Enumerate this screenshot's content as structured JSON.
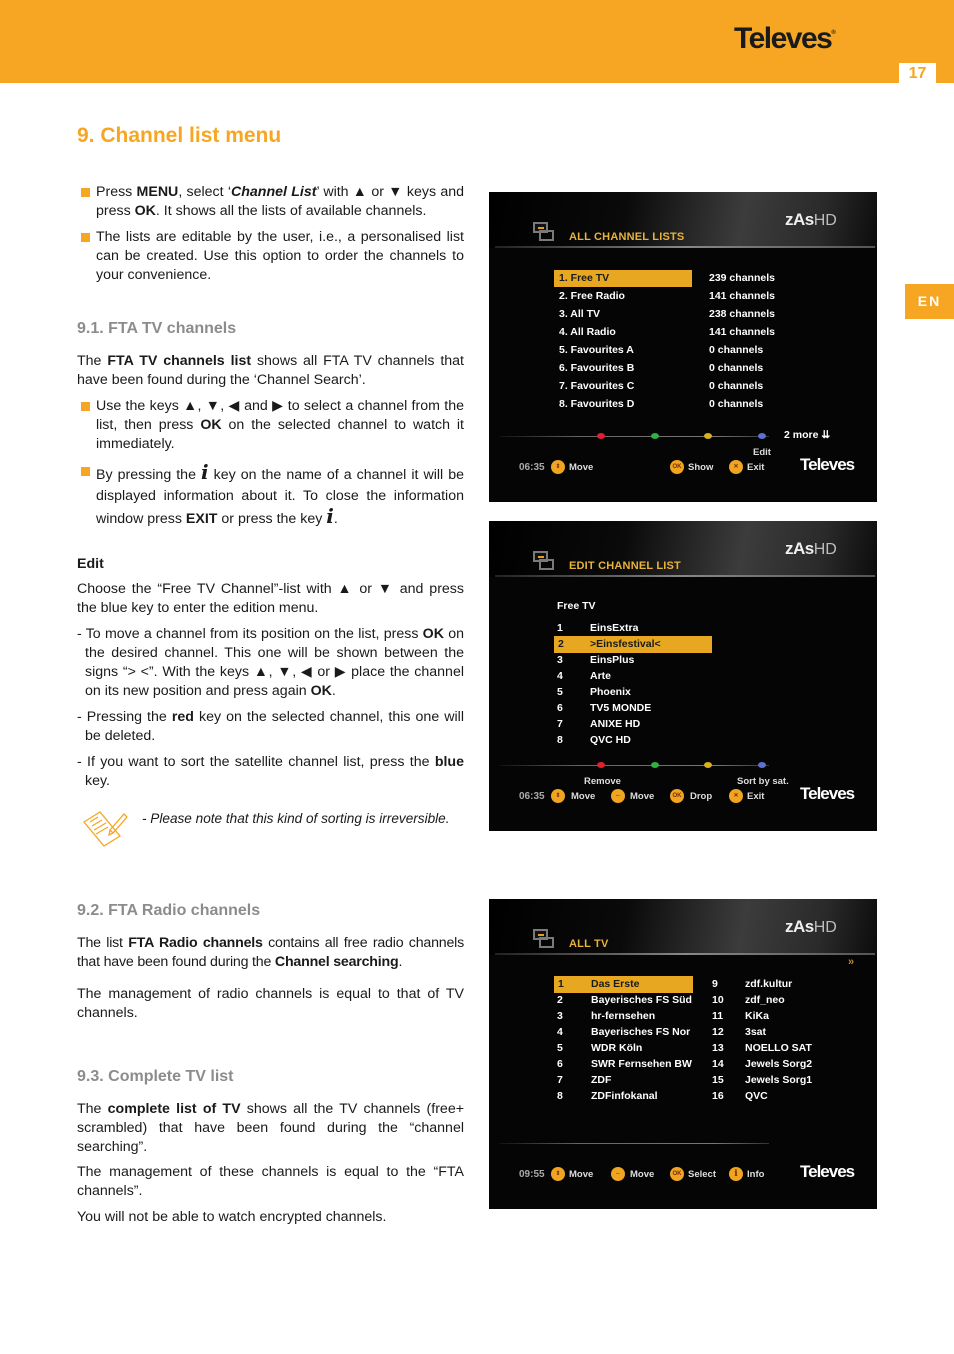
{
  "header": {
    "brand": "Televes",
    "page_number": "17",
    "language_tab": "EN",
    "accent_color": "#f6a623"
  },
  "section": {
    "title": "9. Channel list menu",
    "intro_bullets": [
      {
        "parts": [
          "Press ",
          "MENU",
          ", select ‘",
          "Channel List",
          "’ with ▲ or ▼ keys and press ",
          "OK",
          ". It shows all the lists of available channels."
        ]
      },
      {
        "text": "The lists are editable by the user, i.e., a personalised list can be created. Use this option to order the channels to your convenience."
      }
    ]
  },
  "fta_tv": {
    "title": "9.1. FTA TV channels",
    "intro": [
      "The ",
      "FTA TV channels list",
      " shows all FTA TV channels that have been found during the ‘Channel Search’."
    ],
    "bullets": [
      [
        "Use the keys ▲, ▼, ◀ and ▶ to select a channel from the list, then press ",
        "OK",
        " on the selected channel to watch it immediately."
      ],
      [
        "By pressing the ",
        "i",
        " key on the name of a channel it will be displayed information about it. To close the information window press ",
        "EXIT",
        " or press the key ",
        "i",
        "."
      ]
    ],
    "edit": {
      "title": "Edit",
      "intro": "Choose the “Free TV Channel”-list with ▲ or ▼ and press the blue key to enter the edition menu.",
      "items": [
        [
          "- To move a channel from its position on the list, press ",
          "OK",
          " on the desired channel. This one will be shown between the signs “> <”. With the keys ▲, ▼, ◀ or ▶ place the channel on its new position and press again ",
          "OK",
          "."
        ],
        [
          "- Pressing the ",
          "red",
          " key on the selected channel, this one will be deleted."
        ],
        [
          "- If you want to sort the satellite channel list, press the ",
          "blue",
          " key."
        ]
      ],
      "note": "- Please note that this kind of sorting is irreversible."
    }
  },
  "fta_radio": {
    "title": "9.2. FTA Radio channels",
    "p1": [
      "The list ",
      "FTA Radio channels",
      " contains all free radio channels that have been found during the ",
      "Channel searching",
      "."
    ],
    "p2": "The management of radio channels is equal to that of TV channels."
  },
  "complete_tv": {
    "title": "9.3. Complete TV list",
    "p1": [
      "The ",
      "complete list of TV",
      " shows all the TV channels (free+ scrambled) that have been found during the “channel searching”."
    ],
    "p2": "The management of these channels is equal to the “FTA channels”.",
    "p3": "You will not be able to watch encrypted channels."
  },
  "screens": {
    "all_channel_lists": {
      "title": "ALL CHANNEL LISTS",
      "logo": "zAs",
      "logo_suffix": "HD",
      "rows": [
        {
          "name": "1. Free TV",
          "count": "239 channels",
          "selected": true
        },
        {
          "name": "2. Free Radio",
          "count": "141 channels"
        },
        {
          "name": "3. All TV",
          "count": "238 channels"
        },
        {
          "name": "4. All Radio",
          "count": "141 channels"
        },
        {
          "name": "5. Favourites A",
          "count": "0 channels"
        },
        {
          "name": "6. Favourites B",
          "count": "0 channels"
        },
        {
          "name": "7. Favourites C",
          "count": "0 channels"
        },
        {
          "name": "8. Favourites D",
          "count": "0 channels"
        }
      ],
      "more": "2 more",
      "blue_label": "Edit",
      "time": "06:35",
      "footer": {
        "move": "Move",
        "show": "Show",
        "exit": "Exit"
      },
      "brand": "Televes"
    },
    "edit_channel_list": {
      "title": "EDIT CHANNEL LIST",
      "logo": "zAs",
      "logo_suffix": "HD",
      "list_name": "Free TV",
      "rows": [
        {
          "num": "1",
          "name": "EinsExtra"
        },
        {
          "num": "2",
          "name": ">Einsfestival<",
          "selected": true
        },
        {
          "num": "3",
          "name": "EinsPlus"
        },
        {
          "num": "4",
          "name": "Arte"
        },
        {
          "num": "5",
          "name": "Phoenix"
        },
        {
          "num": "6",
          "name": "TV5 MONDE"
        },
        {
          "num": "7",
          "name": "ANIXE HD"
        },
        {
          "num": "8",
          "name": "QVC HD"
        }
      ],
      "red_label": "Remove",
      "blue_label": "Sort by sat.",
      "time": "06:35",
      "footer": {
        "move_ud": "Move",
        "move_lr": "Move",
        "drop": "Drop",
        "exit": "Exit"
      },
      "brand": "Televes"
    },
    "all_tv": {
      "title": "ALL TV",
      "logo": "zAs",
      "logo_suffix": "HD",
      "next_page": "»",
      "rows_left": [
        {
          "num": "1",
          "name": "Das Erste",
          "selected": true
        },
        {
          "num": "2",
          "name": "Bayerisches FS Süd"
        },
        {
          "num": "3",
          "name": "hr-fernsehen"
        },
        {
          "num": "4",
          "name": "Bayerisches FS Nor"
        },
        {
          "num": "5",
          "name": "WDR Köln"
        },
        {
          "num": "6",
          "name": "SWR Fernsehen BW"
        },
        {
          "num": "7",
          "name": "ZDF"
        },
        {
          "num": "8",
          "name": "ZDFinfokanal"
        }
      ],
      "rows_right": [
        {
          "num": "9",
          "name": "zdf.kultur"
        },
        {
          "num": "10",
          "name": "zdf_neo"
        },
        {
          "num": "11",
          "name": "KiKa"
        },
        {
          "num": "12",
          "name": "3sat"
        },
        {
          "num": "13",
          "name": "NOELLO SAT"
        },
        {
          "num": "14",
          "name": "Jewels Sorg2"
        },
        {
          "num": "15",
          "name": "Jewels Sorg1"
        },
        {
          "num": "16",
          "name": "QVC"
        }
      ],
      "time": "09:55",
      "footer": {
        "move_ud": "Move",
        "move_lr": "Move",
        "select": "Select",
        "info": "Info"
      },
      "brand": "Televes"
    }
  }
}
